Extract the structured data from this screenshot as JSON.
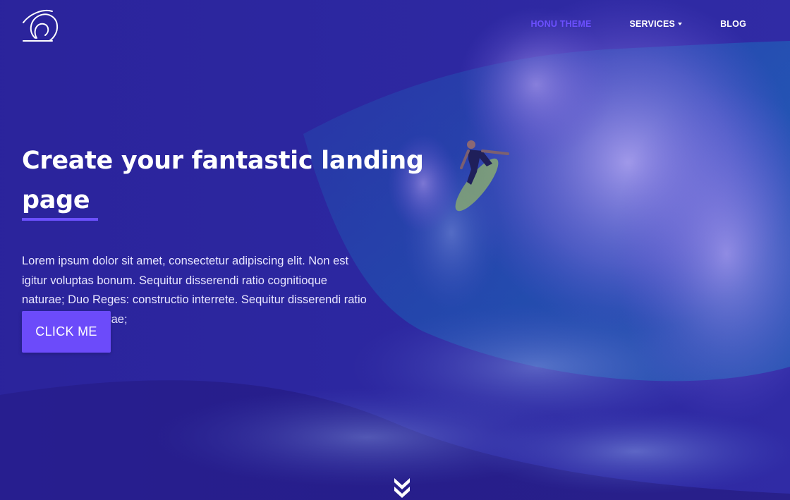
{
  "nav": {
    "logo_icon": "wave-logo-icon",
    "items": [
      {
        "label": "HONU THEME",
        "active": true
      },
      {
        "label": "SERVICES",
        "dropdown": true
      },
      {
        "label": "BLOG"
      }
    ]
  },
  "hero": {
    "title": "Create your fantastic landing page",
    "text": "Lorem ipsum dolor sit amet, consectetur adipiscing elit. Non est igitur voluptas bonum. Sequitur disserendi ratio cognitioque naturae; Duo Reges: constructio interrete. Sequitur disserendi ratio cognitioque naturae;",
    "button_label": "CLICK ME",
    "scroll_icon": "double-chevron-down-icon"
  },
  "colors": {
    "accent": "#6c50ff",
    "overlay": "#2d2ba0"
  }
}
